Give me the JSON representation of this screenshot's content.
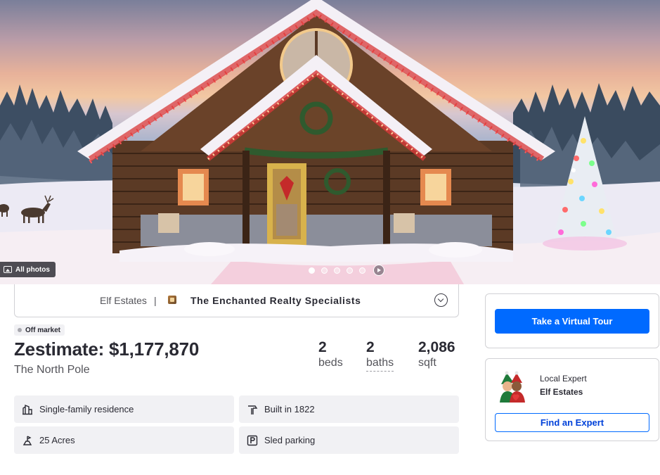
{
  "hero": {
    "all_photos_label": "All photos",
    "carousel": {
      "total_slides": 5,
      "active_index": 0
    }
  },
  "agent": {
    "name": "Elf Estates",
    "separator": "|",
    "brokerage": "The Enchanted Realty Specialists"
  },
  "listing": {
    "status": "Off market",
    "zestimate": "Zestimate: $1,177,870",
    "address": "The North Pole",
    "facts": [
      {
        "value": "2",
        "label": "beds"
      },
      {
        "value": "2",
        "label": "baths"
      },
      {
        "value": "2,086",
        "label": "sqft"
      }
    ],
    "features": [
      {
        "icon": "home-type-icon",
        "text": "Single-family residence"
      },
      {
        "icon": "hammer-icon",
        "text": "Built in 1822"
      },
      {
        "icon": "lot-size-icon",
        "text": "25 Acres"
      },
      {
        "icon": "parking-icon",
        "text": "Sled parking"
      }
    ]
  },
  "sidebar": {
    "tour_button": "Take a Virtual Tour",
    "expert_label": "Local Expert",
    "expert_name": "Elf Estates",
    "find_expert_button": "Find an Expert"
  },
  "colors": {
    "primary": "#006aff",
    "text": "#2a2a33",
    "muted": "#54545a",
    "tile_bg": "#f1f1f4"
  }
}
